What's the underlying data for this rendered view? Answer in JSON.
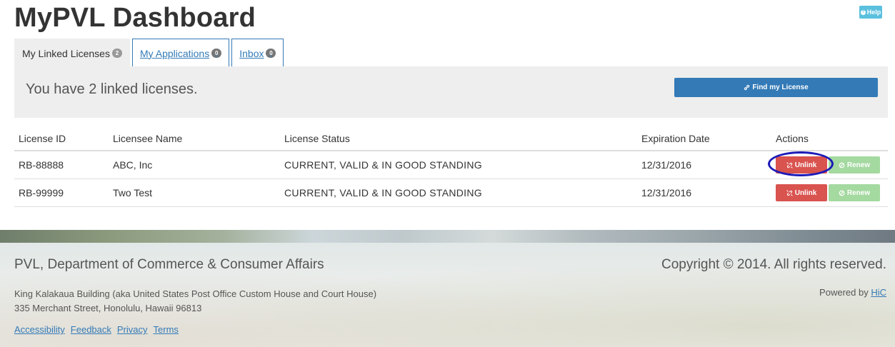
{
  "header": {
    "title": "MyPVL Dashboard",
    "help_label": "Help"
  },
  "tabs": [
    {
      "label": "My Linked Licenses",
      "count": "2",
      "active": true
    },
    {
      "label": "My Applications",
      "count": "0",
      "active": false
    },
    {
      "label": "Inbox",
      "count": "0",
      "active": false
    }
  ],
  "panel": {
    "message": "You have 2 linked licenses.",
    "find_button": "Find my License"
  },
  "table": {
    "headers": [
      "License ID",
      "Licensee Name",
      "License Status",
      "Expiration Date",
      "Actions"
    ],
    "rows": [
      {
        "id": "RB-88888",
        "name": "ABC, Inc",
        "status": "CURRENT, VALID & IN GOOD STANDING",
        "expires": "12/31/2016",
        "unlink": "Unlink",
        "renew": "Renew"
      },
      {
        "id": "RB-99999",
        "name": "Two Test",
        "status": "CURRENT, VALID & IN GOOD STANDING",
        "expires": "12/31/2016",
        "unlink": "Unlink",
        "renew": "Renew"
      }
    ]
  },
  "footer": {
    "department": "PVL, Department of Commerce & Consumer Affairs",
    "copyright": "Copyright © 2014. All rights reserved.",
    "address_line1": "King Kalakaua Building (aka United States Post Office Custom House and Court House)",
    "address_line2": "335 Merchant Street, Honolulu, Hawaii 96813",
    "powered_by": "Powered by",
    "powered_link": "HiC",
    "links": [
      "Accessibility",
      "Feedback",
      "Privacy",
      "Terms"
    ]
  },
  "colors": {
    "primary": "#337ab7",
    "danger": "#d9534f",
    "success_light": "#a4d9a0",
    "info": "#5bc0de",
    "highlight_ring": "#1b1bb8"
  }
}
